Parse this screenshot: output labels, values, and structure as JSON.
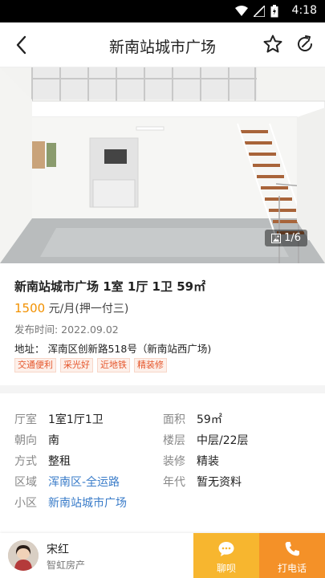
{
  "status_bar": {
    "time": "4:18"
  },
  "nav": {
    "title": "新南站城市广场"
  },
  "photo": {
    "counter": "1/6"
  },
  "listing": {
    "name": "新南站城市广场 1室 1厅 1卫 59㎡",
    "price": "1500",
    "price_unit": " 元/月(押一付三)",
    "date": "发布时间: 2022.09.02",
    "address": "地址： 浑南区创新路518号（新南站西广场)",
    "tags": [
      "交通便利",
      "采光好",
      "近地铁",
      "精装修"
    ]
  },
  "attributes": [
    {
      "key": "厅室",
      "value": "1室1厅1卫"
    },
    {
      "key": "面积",
      "value": "59㎡"
    },
    {
      "key": "朝向",
      "value": "南"
    },
    {
      "key": "楼层",
      "value": "中层/22层"
    },
    {
      "key": "方式",
      "value": "整租"
    },
    {
      "key": "装修",
      "value": "精装"
    },
    {
      "key": "区域",
      "value": "浑南区-全运路"
    },
    {
      "key": "年代",
      "value": "暂无资料"
    },
    {
      "key": "小区",
      "value": "新南站城市广场"
    }
  ],
  "agent": {
    "name": "宋红",
    "company": "智虹房产"
  },
  "actions": {
    "chat": "聊呗",
    "call": "打电话"
  },
  "colors": {
    "price": "#f29100",
    "link": "#3a7cc9",
    "chat_bg": "#f7b62f",
    "call_bg": "#f49128",
    "tag": "#e5562c"
  }
}
